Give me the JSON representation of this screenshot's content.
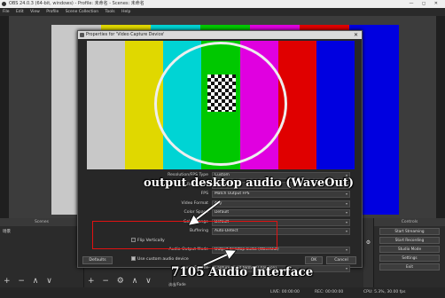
{
  "window": {
    "title": "OBS 24.0.3 (64-bit, windows) - Profile: 未命名 - Scenes: 未命名",
    "controls": "— ◻ ✕"
  },
  "menu": [
    "File",
    "Edit",
    "View",
    "Profile",
    "Scene Collection",
    "Tools",
    "Help"
  ],
  "docks": {
    "scenes": {
      "title": "Scenes",
      "items": [
        "场景"
      ],
      "footer": "+ − ∧ ∨"
    },
    "sources": {
      "footer": "+ − ⚙ ∧ ∨"
    },
    "controls": {
      "title": "Controls",
      "buttons": [
        "Start Streaming",
        "Start Recording",
        "Studio Mode",
        "Settings",
        "Exit"
      ]
    },
    "transitions_label": "淡出/Fade"
  },
  "status": {
    "live": "LIVE: 00:00:00",
    "rec": "REC: 00:00:00",
    "cpu": "CPU: 5.3%, 30.00 fps"
  },
  "dialog": {
    "title": "Properties for 'Video Capture Device'",
    "close": "✕",
    "properties": [
      {
        "label": "Resolution/FPS Type",
        "value": "Custom"
      },
      {
        "label": "Resolution",
        "value": "1920x1080"
      },
      {
        "label": "FPS",
        "value": "Match Output FPS"
      },
      {
        "label": "Video Format",
        "value": "Any"
      },
      {
        "label": "Color Space",
        "value": "Default"
      },
      {
        "label": "Color Range",
        "value": "Default"
      },
      {
        "label": "Buffering",
        "value": "Auto-Detect"
      }
    ],
    "flip_vertically": {
      "label": "Flip Vertically",
      "checked": false
    },
    "audio_output_mode": {
      "label": "Audio Output Mode",
      "value": "Output desktop audio (WaveOut)"
    },
    "custom_audio": {
      "label": "Use custom audio device",
      "checked": true
    },
    "audio_device": {
      "label": "Audio Device",
      "value": "Capture Input terminal (Device)"
    },
    "defaults_button": "Defaults",
    "ok_button": "OK",
    "cancel_button": "Cancel"
  },
  "annotations": {
    "top": "output desktop audio (WaveOut)",
    "bottom": "7105 Audio Interface"
  },
  "colors": {
    "bars": [
      "#c8c8c8",
      "#e0d800",
      "#00d4d4",
      "#00c800",
      "#e000e0",
      "#e00000",
      "#0000e0"
    ],
    "highlight": "#e11111"
  }
}
